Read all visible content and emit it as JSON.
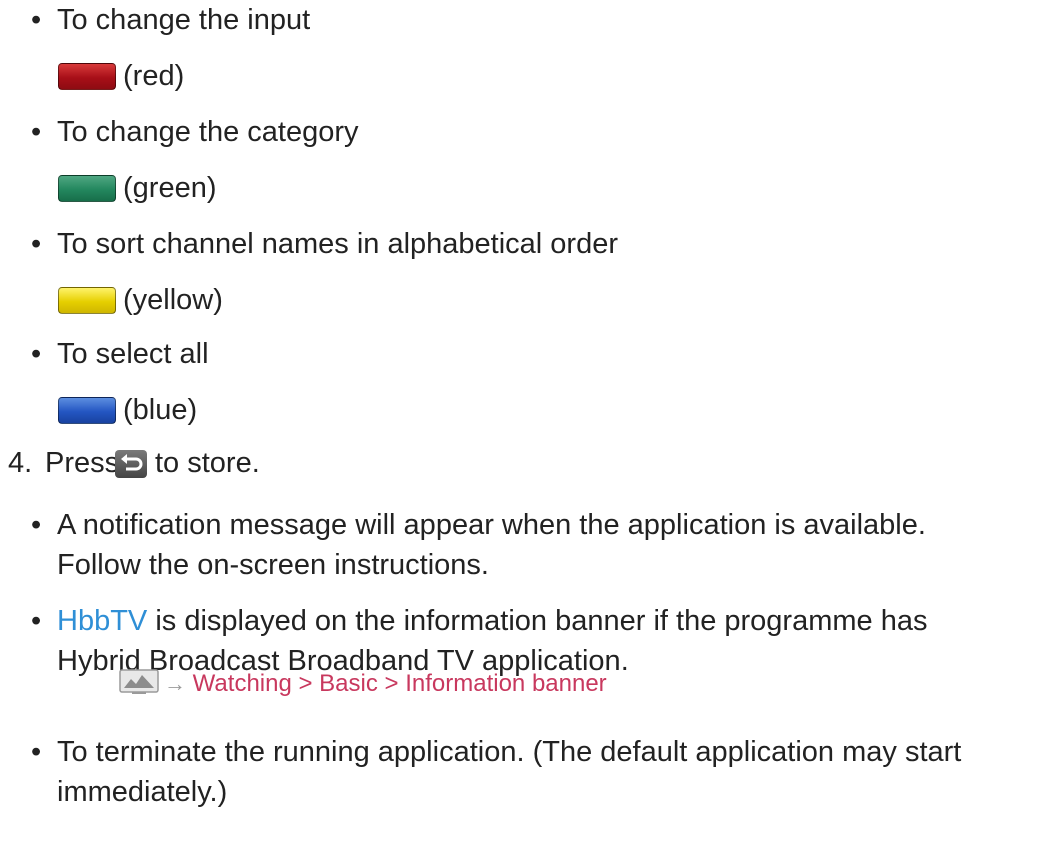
{
  "bullet_glyph": "•",
  "color_buttons": [
    {
      "instruction": "To change the input",
      "color_label": "(red)",
      "icon": "red-button-icon",
      "color": "#b3121c"
    },
    {
      "instruction": "To change the category",
      "color_label": "(green)",
      "icon": "green-button-icon",
      "color": "#23875e"
    },
    {
      "instruction": "To sort channel names in alphabetical order",
      "color_label": "(yellow)",
      "icon": "yellow-button-icon",
      "color": "#e6cf00"
    },
    {
      "instruction": "To select all",
      "color_label": "(blue)",
      "icon": "blue-button-icon",
      "color": "#2456c2"
    }
  ],
  "step4": {
    "number": "4.",
    "press": "Press",
    "icon": "back-return-icon",
    "after": "to store."
  },
  "notes": {
    "notification_line1": "A notification message will appear when the application is available.",
    "notification_line2": "Follow the on-screen instructions.",
    "hbbtv_link": "HbbTV",
    "hbbtv_rest": " is displayed on the information banner if the programme has",
    "hbbtv_line2": "Hybrid Broadcast Broadband TV application.",
    "reference_icon": "tv-screen-icon",
    "reference_arrow": "→",
    "reference_path": "Watching > Basic > Information banner",
    "terminate_line1": "To terminate the running application. (The default application may start",
    "terminate_line2": "immediately.)"
  },
  "link_color": "#2f8fd6",
  "reference_color": "#c8385e"
}
